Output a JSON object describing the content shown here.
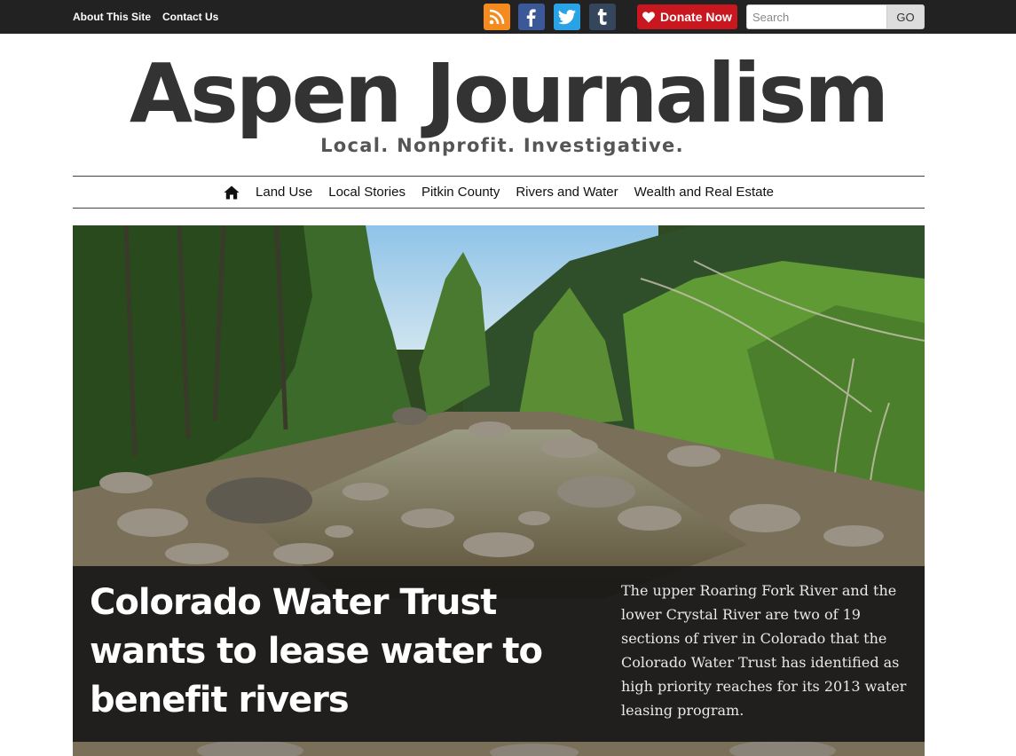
{
  "topbar": {
    "links": [
      "About This Site",
      "Contact Us"
    ],
    "social": [
      {
        "name": "rss-icon",
        "color": "#f58a1f"
      },
      {
        "name": "facebook-icon",
        "color": "#3b5998"
      },
      {
        "name": "twitter-icon",
        "color": "#2aa3e6"
      },
      {
        "name": "tumblr-icon",
        "color": "#35465c"
      }
    ],
    "donate_label": "Donate Now",
    "search_placeholder": "Search",
    "search_button": "GO"
  },
  "masthead": {
    "title": "Aspen Journalism",
    "tagline": "Local. Nonprofit. Investigative."
  },
  "nav": {
    "items": [
      "Land Use",
      "Local Stories",
      "Pitkin County",
      "Rivers and Water",
      "Wealth and Real Estate"
    ]
  },
  "feature": {
    "headline": "Colorado Water Trust wants to lease water to benefit rivers",
    "dek": "The upper Roaring Fork River and the lower Crystal River are two of 19 sections of river in Colorado that the Colorado Water Trust has identified as high priority reaches for its 2013 water leasing program."
  },
  "colors": {
    "topbar": "#222222",
    "donate": "#c8171e",
    "logo": "#333333"
  }
}
